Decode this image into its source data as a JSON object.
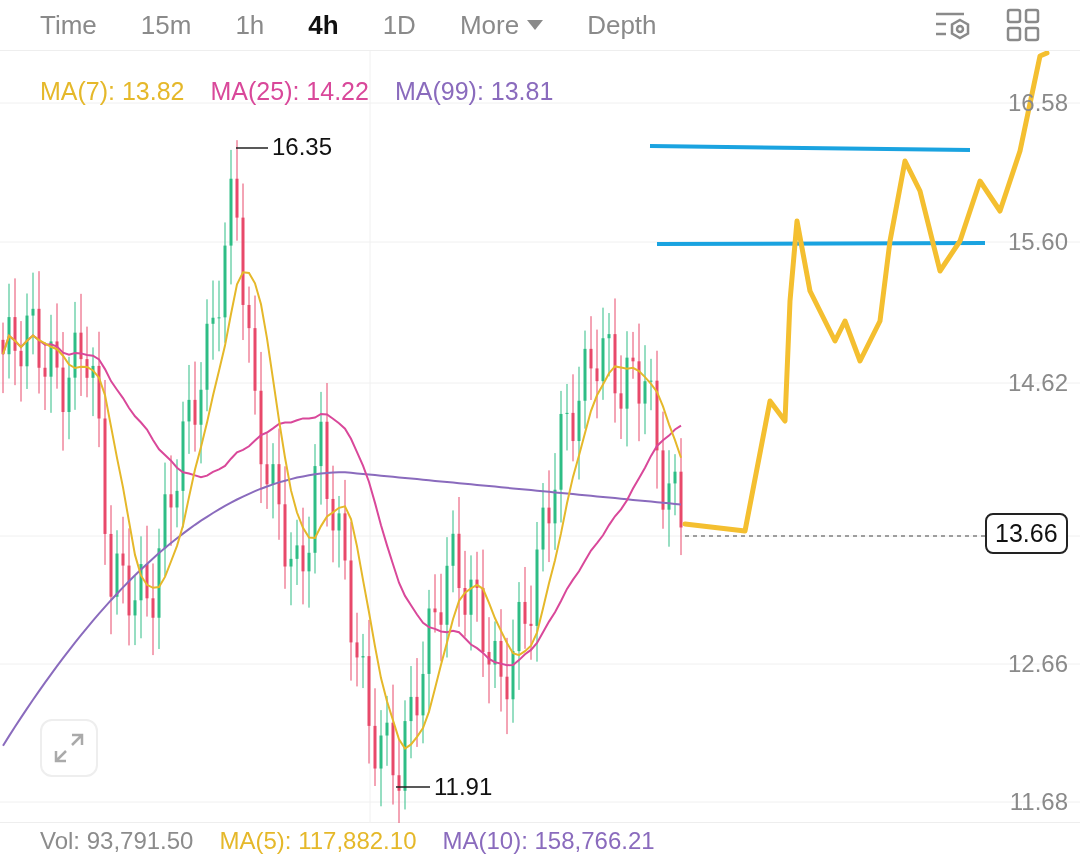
{
  "tabs": [
    {
      "label": "Time",
      "selected": false,
      "kind": "tab"
    },
    {
      "label": "15m",
      "selected": false,
      "kind": "tab"
    },
    {
      "label": "1h",
      "selected": false,
      "kind": "tab"
    },
    {
      "label": "4h",
      "selected": true,
      "kind": "tab"
    },
    {
      "label": "1D",
      "selected": false,
      "kind": "tab"
    },
    {
      "label": "More",
      "selected": false,
      "kind": "dropdown"
    },
    {
      "label": "Depth",
      "selected": false,
      "kind": "tab"
    }
  ],
  "ma_legend": [
    {
      "label": "MA(7): 13.82",
      "color": "#e5b82a"
    },
    {
      "label": "MA(25): 14.22",
      "color": "#d9489a"
    },
    {
      "label": "MA(99): 13.81",
      "color": "#8a6bbd"
    }
  ],
  "price_axis": [
    "16.58",
    "15.60",
    "14.62",
    "12.66",
    "11.68"
  ],
  "high_label": "16.35",
  "low_label": "11.91",
  "last_price": "13.66",
  "volume_legend": [
    {
      "label": "Vol: 93,791.50",
      "color": "#8c8c8c"
    },
    {
      "label": "MA(5): 117,882.10",
      "color": "#e5b82a"
    },
    {
      "label": "MA(10): 158,766.21",
      "color": "#8a6bbd"
    }
  ]
}
